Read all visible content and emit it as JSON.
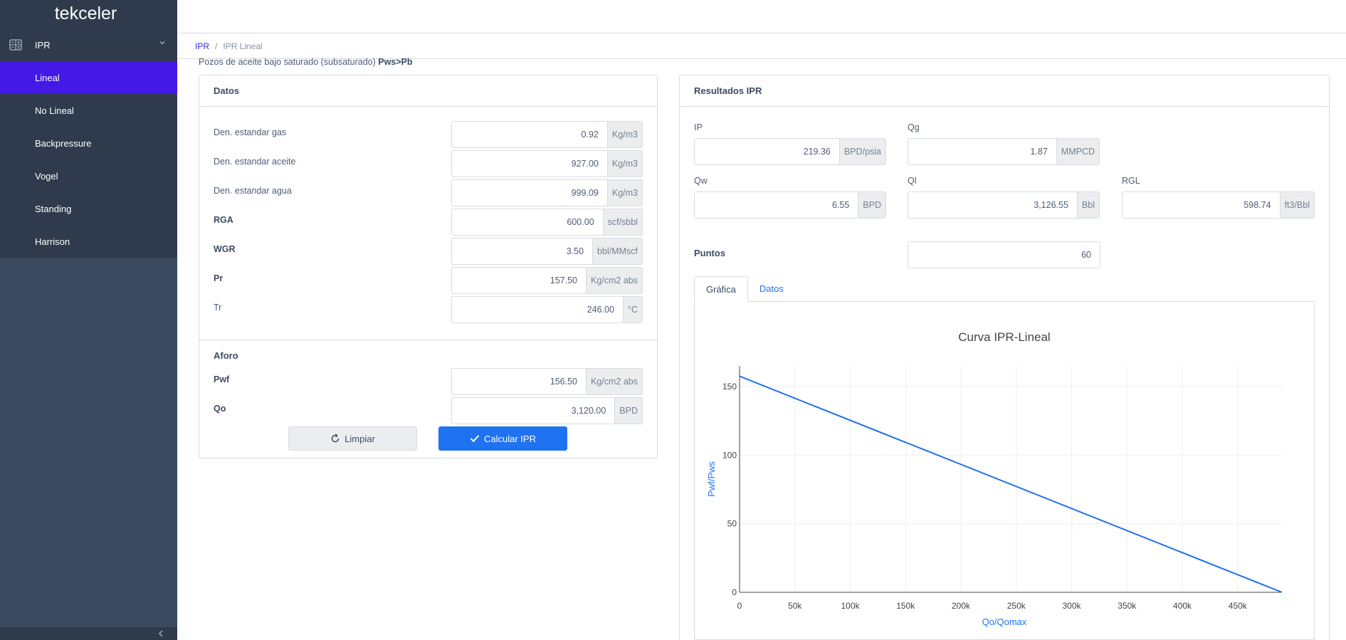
{
  "sidebar": {
    "brand": "tekceler",
    "group_label": "IPR",
    "items": [
      {
        "label": "Lineal",
        "active": true
      },
      {
        "label": "No Lineal",
        "active": false
      },
      {
        "label": "Backpressure",
        "active": false
      },
      {
        "label": "Vogel",
        "active": false
      },
      {
        "label": "Standing",
        "active": false
      },
      {
        "label": "Harrison",
        "active": false
      }
    ]
  },
  "breadcrumb": {
    "root": "IPR",
    "sep": "/",
    "current": "IPR Lineal"
  },
  "subtitle": {
    "text": "Pozos de aceite bajo saturado (subsaturado) ",
    "bold": "Pws>Pb"
  },
  "datos": {
    "title": "Datos",
    "fields": [
      {
        "label": "Den. estandar gas",
        "value": "0.92",
        "unit": "Kg/m3",
        "bold": false
      },
      {
        "label": "Den. estandar aceite",
        "value": "927.00",
        "unit": "Kg/m3",
        "bold": false
      },
      {
        "label": "Den. estandar agua",
        "value": "999.09",
        "unit": "Kg/m3",
        "bold": false
      },
      {
        "label": "RGA",
        "value": "600.00",
        "unit": "scf/sbbl",
        "bold": true
      },
      {
        "label": "WGR",
        "value": "3.50",
        "unit": "bbl/MMscf",
        "bold": true
      },
      {
        "label": "Pr",
        "value": "157.50",
        "unit": "Kg/cm2 abs",
        "bold": true
      },
      {
        "label": "Tr",
        "value": "246.00",
        "unit": "°C",
        "bold": false
      }
    ],
    "aforo_title": "Aforo",
    "aforo": [
      {
        "label": "Pwf",
        "value": "156.50",
        "unit": "Kg/cm2 abs"
      },
      {
        "label": "Qo",
        "value": "3,120.00",
        "unit": "BPD"
      }
    ],
    "btn_clear": "Limpiar",
    "btn_calc": "Calcular IPR"
  },
  "results": {
    "title": "Resultados IPR",
    "ip": {
      "label": "IP",
      "value": "219.36",
      "unit": "BPD/psia"
    },
    "qg": {
      "label": "Qg",
      "value": "1.87",
      "unit": "MMPCD"
    },
    "qw": {
      "label": "Qw",
      "value": "6.55",
      "unit": "BPD"
    },
    "ql": {
      "label": "Ql",
      "value": "3,126.55",
      "unit": "Bbl"
    },
    "rgl": {
      "label": "RGL",
      "value": "598.74",
      "unit": "ft3/Bbl"
    },
    "puntos": {
      "label": "Puntos",
      "value": "60"
    },
    "tabs": [
      {
        "label": "Gráfica",
        "active": true
      },
      {
        "label": "Datos",
        "active": false
      }
    ]
  },
  "colors": {
    "accent": "#1f73f0",
    "active_nav": "#4418e6",
    "sidebar": "#3b4a5f"
  },
  "chart_data": {
    "type": "line",
    "title": "Curva IPR-Lineal",
    "xlabel": "Qo/Qomax",
    "ylabel": "Pwf/Pws",
    "xlim": [
      0,
      490000
    ],
    "ylim": [
      0,
      165
    ],
    "x_ticks": [
      0,
      50000,
      100000,
      150000,
      200000,
      250000,
      300000,
      350000,
      400000,
      450000
    ],
    "x_tick_labels": [
      "0",
      "50k",
      "100k",
      "150k",
      "200k",
      "250k",
      "300k",
      "350k",
      "400k",
      "450k"
    ],
    "y_ticks": [
      0,
      50,
      100,
      150
    ],
    "y_tick_labels": [
      "0",
      "50",
      "100",
      "150"
    ],
    "grid": true,
    "series": [
      {
        "x": [
          0,
          490000
        ],
        "y": [
          157.5,
          0
        ],
        "color": "#1f73f0"
      }
    ]
  }
}
